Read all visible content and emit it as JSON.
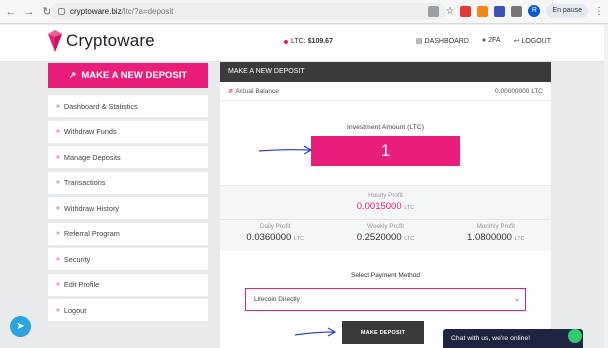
{
  "browser": {
    "url_host": "cryptoware.biz",
    "url_path": "/ltc/?a=deposit",
    "profile_status": "En pause",
    "profile_initial": "R"
  },
  "header": {
    "logo_text": "Cryptoware",
    "price_label": "LTC:",
    "price_value": "$109.67",
    "links": [
      {
        "label": "DASHBOARD",
        "icon": "dashboard-icon"
      },
      {
        "label": "2FA",
        "icon": "user-icon"
      },
      {
        "label": "LOGOUT",
        "icon": "logout-icon"
      }
    ]
  },
  "sidebar": {
    "deposit_button": "MAKE A NEW DEPOSIT",
    "items": [
      {
        "label": "Dashboard & Statistics"
      },
      {
        "label": "Withdraw Funds"
      },
      {
        "label": "Manage Deposits"
      },
      {
        "label": "Transactions"
      },
      {
        "label": "Withdraw History"
      },
      {
        "label": "Referral Program"
      },
      {
        "label": "Security"
      },
      {
        "label": "Edit Profile"
      },
      {
        "label": "Logout"
      }
    ]
  },
  "panel": {
    "title": "MAKE A NEW DEPOSIT",
    "balance_label": "Actual Balance",
    "balance_value": "0.00000000 LTC",
    "invest_label": "Investment Amount (LTC)",
    "invest_value": "1",
    "hourly_label": "Hourly Profit",
    "hourly_value": "0.0015000",
    "currency": "LTC",
    "daily_label": "Daily Profit",
    "daily_value": "0.0360000",
    "weekly_label": "Weekly Profit",
    "weekly_value": "0.2520000",
    "monthly_label": "Monthly Profit",
    "monthly_value": "1.0800000",
    "payment_label": "Select Payment Method",
    "payment_selected": "Litecoin Directly",
    "submit_label": "MAKE DEPOSIT"
  },
  "chat": {
    "text": "Chat with us, we're online!"
  },
  "colors": {
    "accent": "#e91e7a",
    "dark": "#3a3a3a",
    "chat_bg": "#1d2541",
    "arrow": "#2b3bd6"
  }
}
